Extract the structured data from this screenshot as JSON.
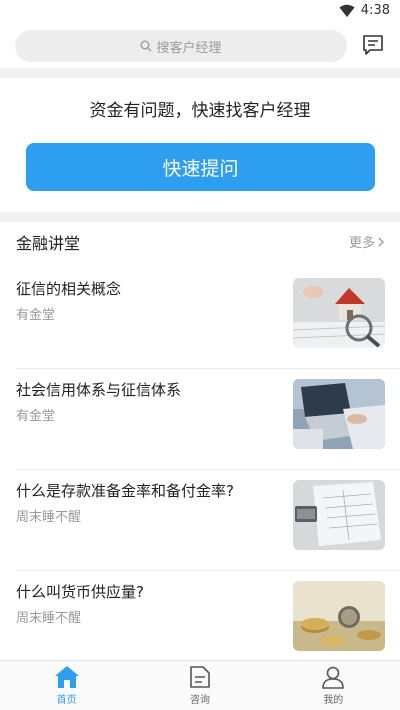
{
  "status_bar": {
    "time": "4:38"
  },
  "search": {
    "placeholder": "搜客户经理"
  },
  "ask_panel": {
    "prompt": "资金有问题，快速找客户经理",
    "button_label": "快速提问"
  },
  "lecture": {
    "title": "金融讲堂",
    "more_label": "更多",
    "articles": [
      {
        "title": "征信的相关概念",
        "source": "有金堂",
        "thumb": "house-model-thumbnail"
      },
      {
        "title": "社会信用体系与征信体系",
        "source": "有金堂",
        "thumb": "laptop-desk-thumbnail"
      },
      {
        "title": "什么是存款准备金率和备付金率?",
        "source": "周末睡不醒",
        "thumb": "paper-documents-thumbnail"
      },
      {
        "title": "什么叫货币供应量?",
        "source": "周末睡不醒",
        "thumb": "coins-thumbnail"
      }
    ]
  },
  "tabs": [
    {
      "label": "首页",
      "icon": "home-icon",
      "active": true
    },
    {
      "label": "咨询",
      "icon": "document-icon",
      "active": false
    },
    {
      "label": "我的",
      "icon": "person-icon",
      "active": false
    }
  ],
  "colors": {
    "accent": "#2d9ef0",
    "divider": "#f2f2f2"
  }
}
